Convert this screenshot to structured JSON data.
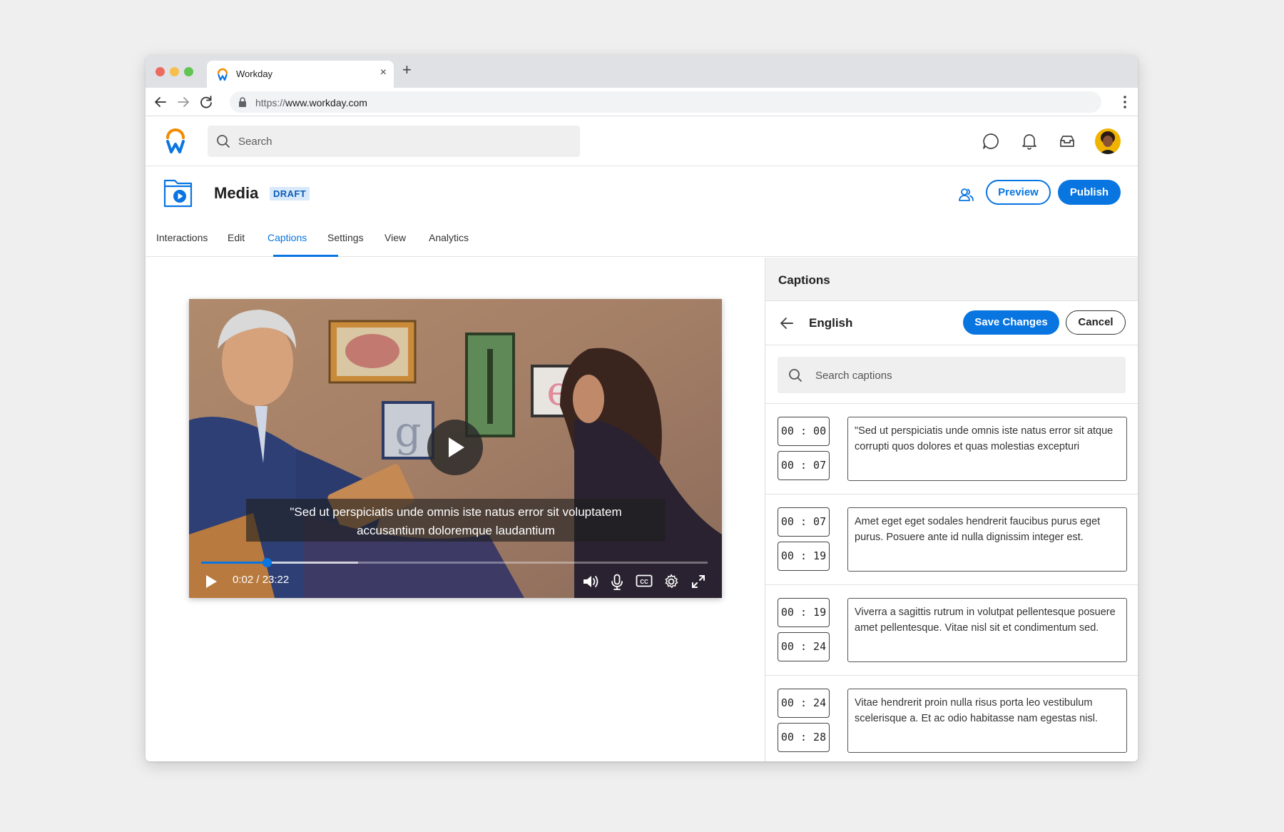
{
  "browser": {
    "tab_title": "Workday",
    "new_tab": "+",
    "close": "×",
    "url_scheme": "https://",
    "url_host": "www.workday.com"
  },
  "header": {
    "search_placeholder": "Search",
    "icons": [
      "chat-icon",
      "bell-icon",
      "inbox-icon",
      "avatar"
    ]
  },
  "page": {
    "title": "Media",
    "badge": "DRAFT",
    "preview_label": "Preview",
    "publish_label": "Publish",
    "tabs": [
      {
        "label": "Interactions",
        "active": false
      },
      {
        "label": "Edit",
        "active": false
      },
      {
        "label": "Captions",
        "active": true
      },
      {
        "label": "Settings",
        "active": false
      },
      {
        "label": "View",
        "active": false
      },
      {
        "label": "Analytics",
        "active": false
      }
    ]
  },
  "video": {
    "subtitle_line1": "\"Sed ut perspiciatis unde omnis iste natus error sit voluptatem",
    "subtitle_line2": "accusantium doloremque laudantium",
    "time": "0:02 / 23:22",
    "progress": 0.13,
    "buffered": 0.31
  },
  "captions_panel": {
    "title": "Captions",
    "language": "English",
    "save_label": "Save Changes",
    "cancel_label": "Cancel",
    "search_placeholder": "Search captions",
    "items": [
      {
        "start": "00 : 00",
        "end": "00 : 07",
        "text": "\"Sed ut perspiciatis unde omnis iste natus error sit atque corrupti quos dolores et quas molestias excepturi"
      },
      {
        "start": "00 : 07",
        "end": "00 : 19",
        "text": "Amet eget eget sodales hendrerit faucibus purus eget purus. Posuere ante id nulla dignissim integer est."
      },
      {
        "start": "00 : 19",
        "end": "00 : 24",
        "text": "Viverra a sagittis rutrum in volutpat pellentesque posuere amet pellentesque. Vitae nisl sit et condimentum sed."
      },
      {
        "start": "00 : 24",
        "end": "00 : 28",
        "text": "Vitae hendrerit proin nulla risus porta leo vestibulum scelerisque a. Et ac odio habitasse nam egestas nisl."
      }
    ]
  },
  "colors": {
    "accent": "#0875e1",
    "badge_bg": "#d8e9fb",
    "logo_orange": "#f38b00",
    "logo_blue": "#0875e1"
  }
}
